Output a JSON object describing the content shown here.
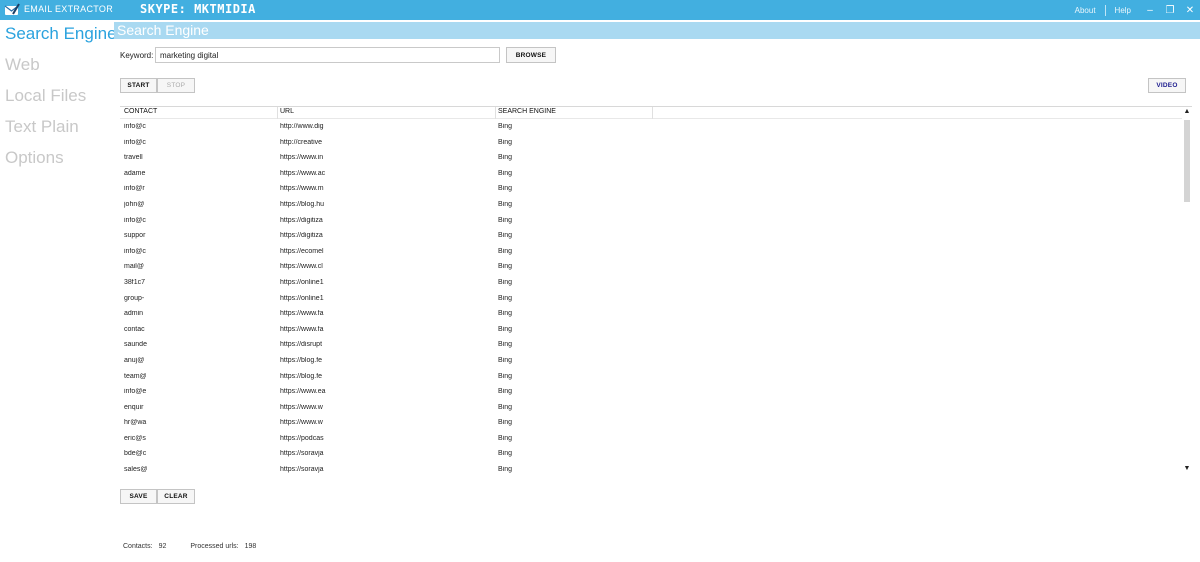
{
  "titlebar": {
    "app_title": "EMAIL EXTRACTOR",
    "skype": "SKYPE: MKTMIDIA",
    "about": "About",
    "help": "Help",
    "minimize": "–",
    "restore": "❐",
    "close": "✕",
    "accent_color": "#42afe0"
  },
  "sidebar": {
    "items": [
      {
        "label": "Search Engine",
        "active": true
      },
      {
        "label": "Web",
        "active": false
      },
      {
        "label": "Local Files",
        "active": false
      },
      {
        "label": "Text Plain",
        "active": false
      },
      {
        "label": "Options",
        "active": false
      }
    ]
  },
  "section": {
    "title": "Search Engine"
  },
  "search": {
    "keyword_label": "Keyword:",
    "keyword_value": "marketing digital",
    "browse_label": "BROWSE",
    "start_label": "START",
    "stop_label": "STOP",
    "video_label": "VIDEO"
  },
  "table": {
    "columns": [
      "CONTACT",
      "URL",
      "SEARCH ENGINE"
    ],
    "rows": [
      [
        "info@c",
        "http://www.dig",
        "Bing"
      ],
      [
        "info@c",
        "http://creative",
        "Bing"
      ],
      [
        "travell",
        "https://www.in",
        "Bing"
      ],
      [
        "adame",
        "https://www.ac",
        "Bing"
      ],
      [
        "info@r",
        "https://www.m",
        "Bing"
      ],
      [
        "john@",
        "https://blog.hu",
        "Bing"
      ],
      [
        "info@c",
        "https://digitiza",
        "Bing"
      ],
      [
        "suppor",
        "https://digitiza",
        "Bing"
      ],
      [
        "info@c",
        "https://ecomel",
        "Bing"
      ],
      [
        "mail@",
        "https://www.cl",
        "Bing"
      ],
      [
        "38f1c7",
        "https://online1",
        "Bing"
      ],
      [
        "group-",
        "https://online1",
        "Bing"
      ],
      [
        "admin",
        "https://www.fa",
        "Bing"
      ],
      [
        "contac",
        "https://www.fa",
        "Bing"
      ],
      [
        "saunde",
        "https://disrupt",
        "Bing"
      ],
      [
        "anuj@",
        "https://blog.fe",
        "Bing"
      ],
      [
        "team@",
        "https://blog.fe",
        "Bing"
      ],
      [
        "info@e",
        "https://www.ea",
        "Bing"
      ],
      [
        "enquir",
        "https://www.w",
        "Bing"
      ],
      [
        "hr@wa",
        "https://www.w",
        "Bing"
      ],
      [
        "eric@s",
        "https://podcas",
        "Bing"
      ],
      [
        "bde@c",
        "https://soravja",
        "Bing"
      ],
      [
        "sales@",
        "https://soravja",
        "Bing"
      ]
    ]
  },
  "actions": {
    "save_label": "SAVE",
    "clear_label": "CLEAR"
  },
  "status": {
    "contacts_label": "Contacts:",
    "contacts_value": "92",
    "urls_label": "Processed urls:",
    "urls_value": "198"
  }
}
